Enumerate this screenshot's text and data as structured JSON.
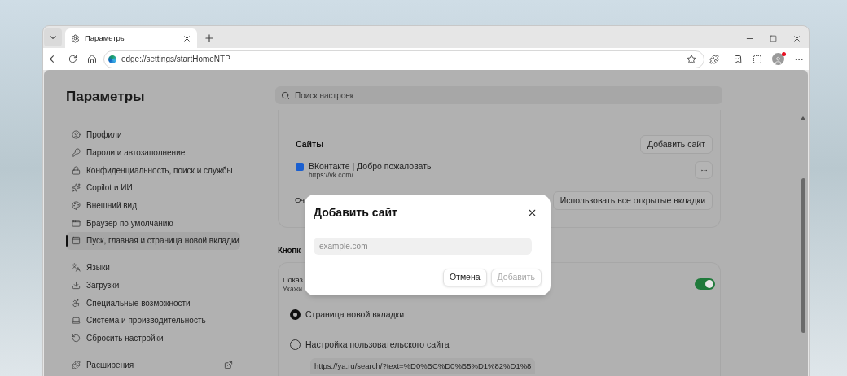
{
  "browser": {
    "tab": {
      "title": "Параметры",
      "selected": true
    },
    "address": "edge://settings/startHomeNTP"
  },
  "settings": {
    "title": "Параметры",
    "search_placeholder": "Поиск настроек",
    "nav": [
      {
        "kind": "profile",
        "label": "Профили",
        "selected": false
      },
      {
        "kind": "key",
        "label": "Пароли и автозаполнение",
        "selected": false
      },
      {
        "kind": "lock",
        "label": "Конфиденциальность, поиск и службы",
        "selected": false
      },
      {
        "kind": "copilot",
        "label": "Copilot и ИИ",
        "selected": false
      },
      {
        "kind": "palette",
        "label": "Внешний вид",
        "selected": false
      },
      {
        "kind": "browser",
        "label": "Браузер по умолчанию",
        "selected": false
      },
      {
        "kind": "tab",
        "label": "Пуск, главная и страница новой вкладки",
        "selected": true
      },
      {
        "kind": "languages",
        "label": "Языки",
        "selected": false
      },
      {
        "kind": "download",
        "label": "Загрузки",
        "selected": false
      },
      {
        "kind": "accessibility",
        "label": "Специальные возможности",
        "selected": false
      },
      {
        "kind": "laptop",
        "label": "Система и производительность",
        "selected": false
      },
      {
        "kind": "reset",
        "label": "Сбросить настройки",
        "selected": false
      },
      {
        "kind": "extensions",
        "label": "Расширения",
        "selected": false
      }
    ]
  },
  "sites_card": {
    "heading": "Сайты",
    "add_button": "Добавить сайт",
    "sites": [
      {
        "title": "ВКонтакте | Добро пожаловать",
        "url": "https://vk.com/"
      }
    ],
    "partial_label": "Оч",
    "use_open_tabs_button": "Использовать все открытые вкладки"
  },
  "home_button_section": {
    "heading": "Кнопк",
    "row_label": "Показ",
    "row_hint": "Укажи",
    "toggle": {
      "on": true
    },
    "options": [
      {
        "label": "Страница новой вкладки",
        "selected": true
      },
      {
        "label": "Настройка пользовательского сайта",
        "selected": false
      }
    ],
    "custom_url": "https://ya.ru/search/?text=%D0%BC%D0%B5%D1%82%D1%8"
  },
  "dialog": {
    "title": "Добавить сайт",
    "placeholder": "example.com",
    "cancel": "Отмена",
    "add": "Добавить",
    "add_disabled": true
  }
}
